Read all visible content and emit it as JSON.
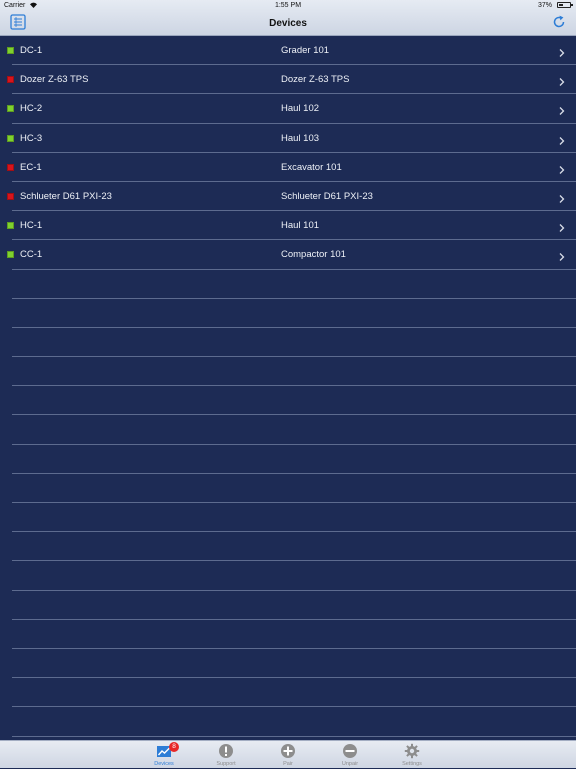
{
  "status_bar": {
    "carrier": "Carrier",
    "time": "1:55 PM",
    "battery": "37%",
    "battery_level": 0.37
  },
  "nav": {
    "title": "Devices",
    "left_icon": "list-icon",
    "right_icon": "refresh-icon"
  },
  "colors": {
    "background": "#1d2b55",
    "status_ok": "#7fd12e",
    "status_alert": "#d8141c",
    "accent": "#2d7dd6",
    "badge": "#e82727"
  },
  "devices": [
    {
      "name": "DC-1",
      "unit": "Grader 101",
      "status": "ok"
    },
    {
      "name": "Dozer Z-63 TPS",
      "unit": "Dozer Z-63 TPS",
      "status": "alert"
    },
    {
      "name": "HC-2",
      "unit": "Haul 102",
      "status": "ok"
    },
    {
      "name": "HC-3",
      "unit": "Haul 103",
      "status": "ok"
    },
    {
      "name": "EC-1",
      "unit": "Excavator 101",
      "status": "alert"
    },
    {
      "name": "Schlueter D61 PXI-23",
      "unit": "Schlueter D61 PXI-23",
      "status": "alert"
    },
    {
      "name": "HC-1",
      "unit": "Haul 101",
      "status": "ok"
    },
    {
      "name": "CC-1",
      "unit": "Compactor 101",
      "status": "ok"
    }
  ],
  "tabs": [
    {
      "label": "Devices",
      "icon": "devices-chart-icon",
      "badge": "8",
      "active": true
    },
    {
      "label": "Support",
      "icon": "exclamation-icon",
      "active": false
    },
    {
      "label": "Pair",
      "icon": "plus-circle-icon",
      "active": false
    },
    {
      "label": "Unpair",
      "icon": "minus-circle-icon",
      "active": false
    },
    {
      "label": "Settings",
      "icon": "gear-icon",
      "active": false
    }
  ]
}
